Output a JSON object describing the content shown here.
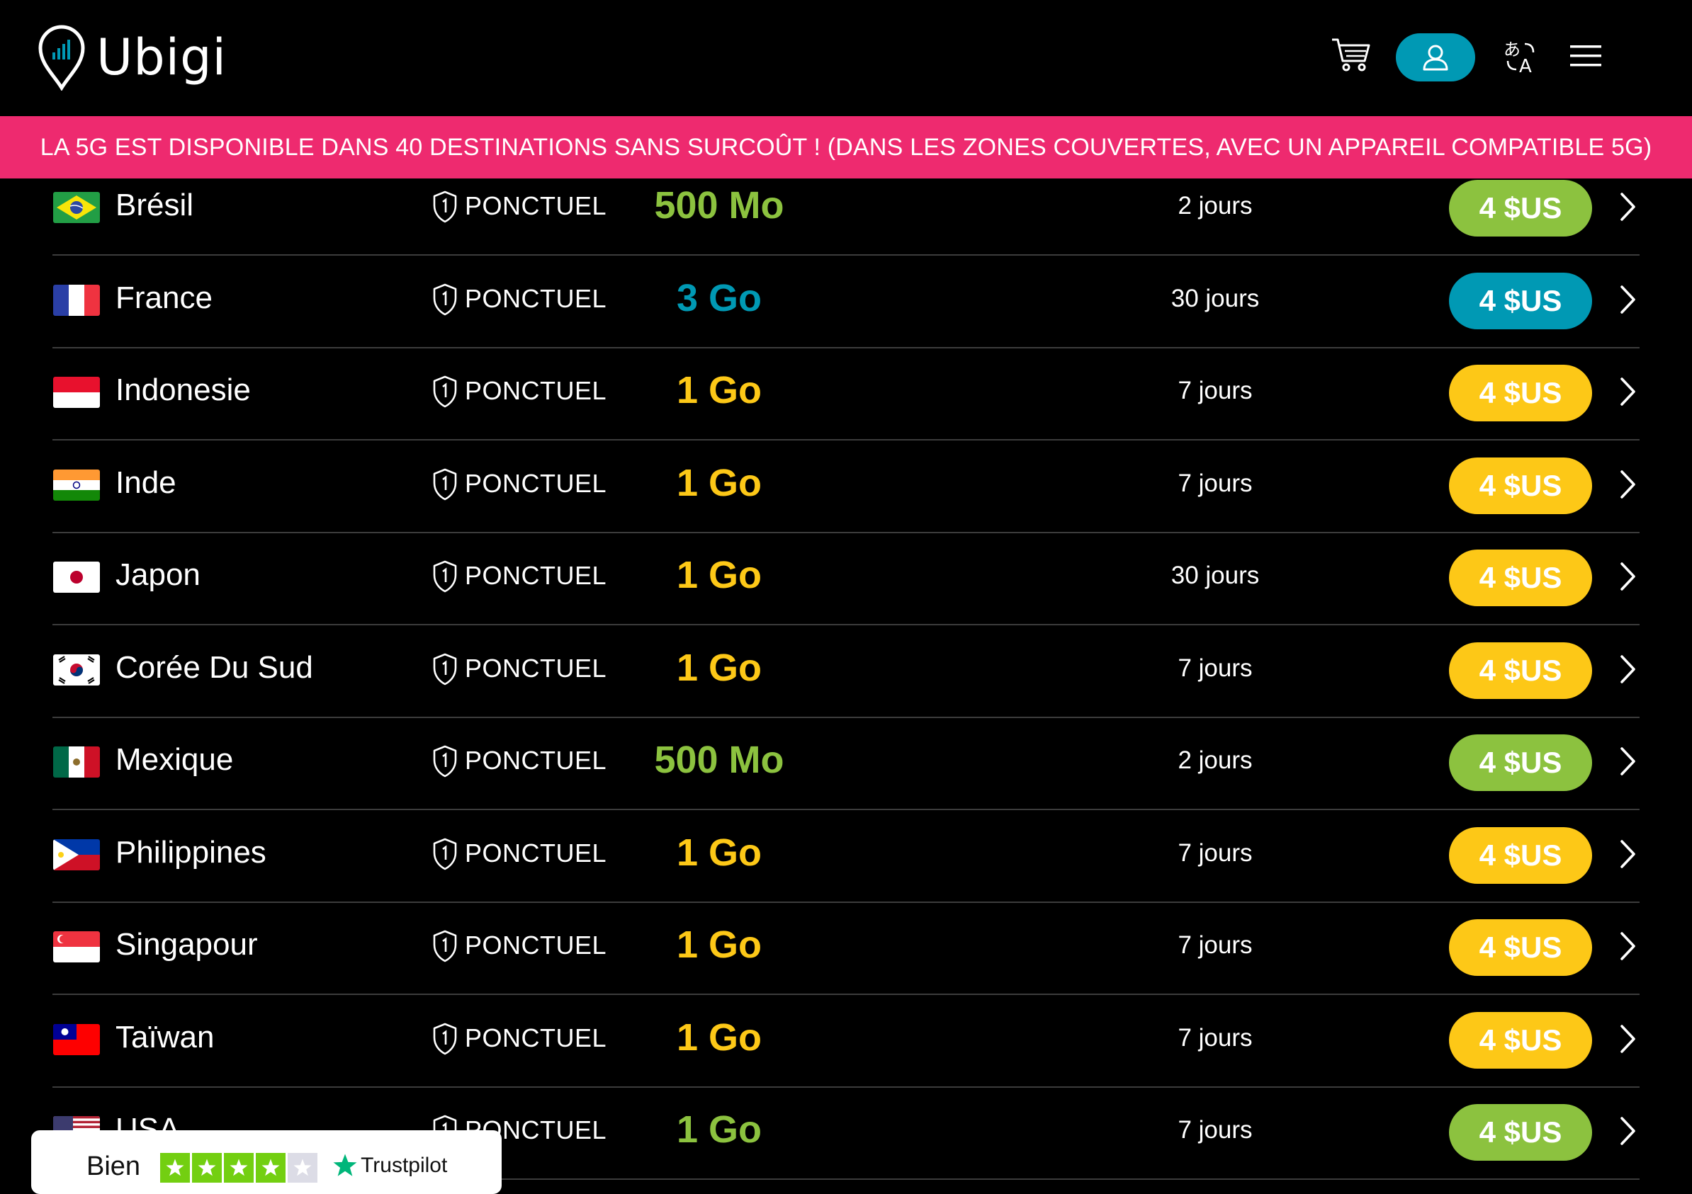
{
  "header": {
    "brand": "Ubigi"
  },
  "banner": {
    "text": "LA 5G EST DISPONIBLE DANS 40 DESTINATIONS SANS SURCOÛT ! (DANS LES ZONES COUVERTES, AVEC UN APPAREIL COMPATIBLE 5G)"
  },
  "colors": {
    "accent": "#0099b4",
    "banner": "#ee2a6f",
    "green": "#8cc23f",
    "teal": "#0099b4",
    "yellow": "#fdc817"
  },
  "icons": [
    "cart-icon",
    "user-icon",
    "translate-icon",
    "hamburger-menu-icon",
    "shield-icon",
    "chevron-right-icon",
    "trustpilot-star-icon"
  ],
  "plans": [
    {
      "country": "Brésil",
      "flag": "brazil",
      "type": "PONCTUEL",
      "data": "500 Mo",
      "duration": "2 jours",
      "price": "4 $US",
      "color": "green"
    },
    {
      "country": "France",
      "flag": "france",
      "type": "PONCTUEL",
      "data": "3 Go",
      "duration": "30 jours",
      "price": "4 $US",
      "color": "teal"
    },
    {
      "country": "Indonesie",
      "flag": "indonesia",
      "type": "PONCTUEL",
      "data": "1 Go",
      "duration": "7 jours",
      "price": "4 $US",
      "color": "yellow"
    },
    {
      "country": "Inde",
      "flag": "india",
      "type": "PONCTUEL",
      "data": "1 Go",
      "duration": "7 jours",
      "price": "4 $US",
      "color": "yellow"
    },
    {
      "country": "Japon",
      "flag": "japan",
      "type": "PONCTUEL",
      "data": "1 Go",
      "duration": "30 jours",
      "price": "4 $US",
      "color": "yellow"
    },
    {
      "country": "Corée Du Sud",
      "flag": "south-korea",
      "type": "PONCTUEL",
      "data": "1 Go",
      "duration": "7 jours",
      "price": "4 $US",
      "color": "yellow"
    },
    {
      "country": "Mexique",
      "flag": "mexico",
      "type": "PONCTUEL",
      "data": "500 Mo",
      "duration": "2 jours",
      "price": "4 $US",
      "color": "green"
    },
    {
      "country": "Philippines",
      "flag": "philippines",
      "type": "PONCTUEL",
      "data": "1 Go",
      "duration": "7 jours",
      "price": "4 $US",
      "color": "yellow"
    },
    {
      "country": "Singapour",
      "flag": "singapore",
      "type": "PONCTUEL",
      "data": "1 Go",
      "duration": "7 jours",
      "price": "4 $US",
      "color": "yellow"
    },
    {
      "country": "Taïwan",
      "flag": "taiwan",
      "type": "PONCTUEL",
      "data": "1 Go",
      "duration": "7 jours",
      "price": "4 $US",
      "color": "yellow"
    },
    {
      "country": "USA",
      "flag": "usa",
      "type": "PONCTUEL",
      "data": "1 Go",
      "duration": "7 jours",
      "price": "4 $US",
      "color": "green"
    }
  ],
  "trustpilot": {
    "rating_label": "Bien",
    "stars_filled": 4,
    "stars_total": 5,
    "brand": "Trustpilot"
  }
}
